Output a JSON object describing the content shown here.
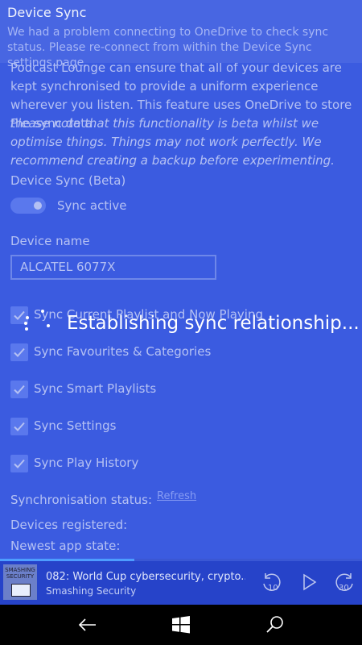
{
  "banner": {
    "title": "Device Sync",
    "message": "We had a problem connecting to OneDrive to check sync status. Please re-connect from within the Device Sync settings page."
  },
  "content": {
    "description": "Podcast Lounge can ensure that all of your devices are kept synchronised to provide a uniform experience wherever you listen. This feature uses OneDrive to store the sync data.",
    "beta_note": "Please note that this functionality is beta whilst we optimise things. Things may not work perfectly. We recommend creating a backup before experimenting.",
    "device_sync_label": "Device Sync (Beta)",
    "toggle_label": "Sync active",
    "device_name_label": "Device name",
    "device_name_value": "ALCATEL 6077X",
    "checkboxes": [
      "Sync Current Playlist and Now Playing",
      "Sync Favourites & Categories",
      "Sync Smart Playlists",
      "Sync Settings",
      "Sync Play History"
    ],
    "sync_status_label": "Synchronisation status:",
    "refresh_label": "Refresh",
    "devices_registered_label": "Devices registered:",
    "newest_app_state_label": "Newest app state:"
  },
  "overlay": {
    "message": "Establishing sync relationship..."
  },
  "player": {
    "episode_title": "082: World Cup cybersecurity, crypto...",
    "podcast_name": "Smashing Security",
    "thumb_text": "SMASHING SECURITY",
    "rewind_label": "10",
    "forward_label": "30",
    "progress": 0.37
  },
  "colors": {
    "background": "#3b5be0",
    "accent": "#6d8af5",
    "player": "#2643c9",
    "progress": "#4d9dff"
  }
}
